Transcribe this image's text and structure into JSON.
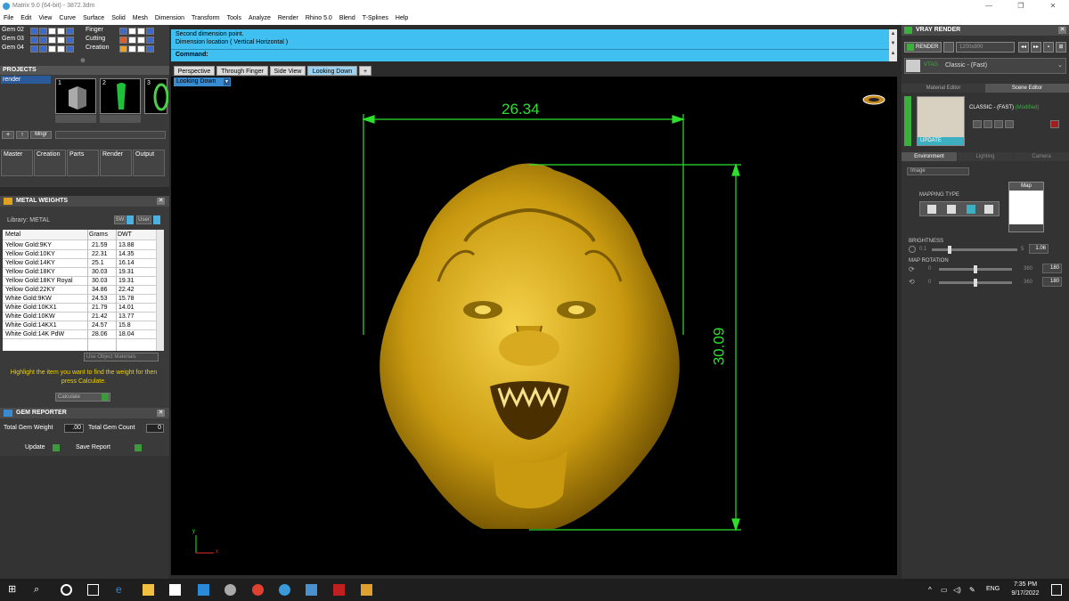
{
  "window": {
    "title": "Matrix 9.0 (64-bit) - 3872.3dm",
    "controls": [
      "—",
      "❐",
      "✕"
    ]
  },
  "menu": [
    "File",
    "Edit",
    "View",
    "Curve",
    "Surface",
    "Solid",
    "Mesh",
    "Dimension",
    "Transform",
    "Tools",
    "Analyze",
    "Render",
    "Rhino 5.0",
    "Blend",
    "T-Splines",
    "Help"
  ],
  "layers": {
    "left": [
      "Gem 02",
      "Gem 03",
      "Gem 04"
    ],
    "right": [
      "Finger",
      "Cutting",
      "Creation"
    ]
  },
  "projects": {
    "header": "PROJECTS",
    "item": "render",
    "thumbs": [
      "1",
      "2",
      "3"
    ],
    "mngr": "Mngr"
  },
  "tabs": [
    "Master",
    "Creation",
    "Parts",
    "Render",
    "Output"
  ],
  "metal_weights": {
    "header": "METAL WEIGHTS",
    "library_label": "Library: METAL",
    "sw_label": "SW",
    "user_label": "User",
    "columns": [
      "Metal",
      "Grams",
      "DWT"
    ],
    "rows": [
      [
        "Yellow Gold:9KY",
        "21.59",
        "13.88"
      ],
      [
        "Yellow Gold:10KY",
        "22.31",
        "14.35"
      ],
      [
        "Yellow Gold:14KY",
        "25.1",
        "16.14"
      ],
      [
        "Yellow Gold:18KY",
        "30.03",
        "19.31"
      ],
      [
        "Yellow Gold:18KY Royal",
        "30.03",
        "19.31"
      ],
      [
        "Yellow Gold:22KY",
        "34.86",
        "22.42"
      ],
      [
        "White Gold:9KW",
        "24.53",
        "15.78"
      ],
      [
        "White Gold:10KX1",
        "21.79",
        "14.01"
      ],
      [
        "White Gold:10KW",
        "21.42",
        "13.77"
      ],
      [
        "White Gold:14KX1",
        "24.57",
        "15.8"
      ],
      [
        "White Gold:14K PdW",
        "28.06",
        "18.04"
      ]
    ],
    "use_object_materials": "Use Object Materials",
    "hint": "Highlight the item you want to find the weight for then press Calculate.",
    "calculate": "Calculate"
  },
  "gem_reporter": {
    "header": "GEM REPORTER",
    "total_gem_weight_label": "Total Gem Weight",
    "total_gem_weight_value": ".00",
    "total_gem_count_label": "Total Gem Count",
    "total_gem_count_value": "0",
    "update": "Update",
    "save_report": "Save Report"
  },
  "command": {
    "line1": "Second dimension point.",
    "line2": "Dimension location ( Vertical  Horizontal )",
    "prompt": "Command:"
  },
  "viewport_tabs": [
    "Perspective",
    "Through Finger",
    "Side View",
    "Looking Down"
  ],
  "viewport": {
    "label": "Looking Down",
    "dim_width": "26.34",
    "dim_height": "30.09",
    "axis_y": "y",
    "axis_x": "x"
  },
  "vray": {
    "header": "VRAY RENDER",
    "render_label": "RENDER",
    "resolution": "1200x900",
    "preset": "Classic - (Fast)",
    "vtag": "VTAG",
    "tabs": [
      "Material Editor",
      "Scene Editor"
    ],
    "classic_title": "CLASSIC - (FAST)",
    "modified": "(Modified)",
    "update": "UPDATE",
    "subtabs": [
      "Environment",
      "Lighting",
      "Camera"
    ],
    "image_dropdown": "Image",
    "map_label": "Map",
    "mapping_type": "MAPPING TYPE",
    "brightness_label": "BRIGHTNESS",
    "brightness_min": "0.1",
    "brightness_max": "5",
    "brightness_value": "1.06",
    "map_rotation_label": "MAP ROTATION",
    "rot1_min": "0",
    "rot1_max": "360",
    "rot1_value": "180",
    "rot2_min": "0",
    "rot2_max": "360",
    "rot2_value": "180"
  },
  "taskbar": {
    "lang": "ENG",
    "time": "7:35 PM",
    "date": "9/17/2022"
  }
}
